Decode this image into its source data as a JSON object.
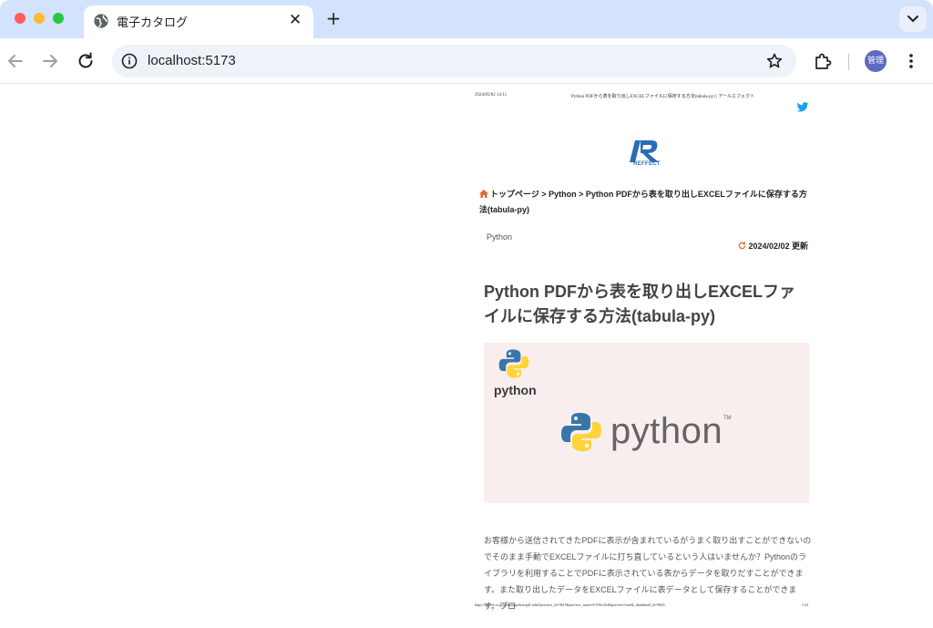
{
  "browser": {
    "tab_title": "電子カタログ",
    "url": "localhost:5173",
    "profile_label": "管理",
    "new_tab_label": "+",
    "close_tab_label": "✕"
  },
  "document": {
    "header_date": "2024/05/02 14:11",
    "header_title": "Python PDFから表を取り出しEXCELファイルに保存する方法(tabula-py) | アールエフェクト",
    "logo_text": "REFFECT",
    "breadcrumb": {
      "home": "トップページ",
      "sep1": " > ",
      "category": "Python",
      "sep2": " > ",
      "current": "Python PDFから表を取り出しEXCELファイルに保存する方法(tabula-py)"
    },
    "category_tag": "Python",
    "updated": "2024/02/02 更新",
    "post_title": "Python PDFから表を取り出しEXCELファイルに保存する方法(tabula-py)",
    "eyecatch": {
      "small_text": "python",
      "big_text": "python",
      "tm": "TM"
    },
    "body_text": "お客様から送信されてきたPDFに表示が含まれているがうまく取り出すことができないのでそのまま手動でEXCELファイルに打ち直しているという人はいませんか？Pythonのライブラリを利用することでPDFに表示されている表からデータを取りだすことができます。また取り出したデータをEXCELファイルに表データとして保存することができます。プロ",
    "footer_url": "https://reffect.co.jp/python/python-pdf-table?preview_id=9615&preview_nonce=b7f0ce1b4&preview=true&_thumbnail_id=9643",
    "footer_page": "1/24"
  },
  "colors": {
    "tabstrip": "#d3e3fd",
    "twitter": "#1da1f2",
    "logo": "#2a6db6",
    "eyecatch_bg": "#f8eeed",
    "python_blue": "#3776ab",
    "python_yellow": "#ffd43b",
    "home_icon": "#e06a2b"
  },
  "icons": {
    "favicon": "globe-icon",
    "back": "arrow-left-icon",
    "forward": "arrow-right-icon",
    "reload": "reload-icon",
    "info": "info-icon",
    "bookmark": "star-icon",
    "extensions": "puzzle-icon",
    "menu": "kebab-menu-icon",
    "tab_search": "chevron-down-icon"
  }
}
